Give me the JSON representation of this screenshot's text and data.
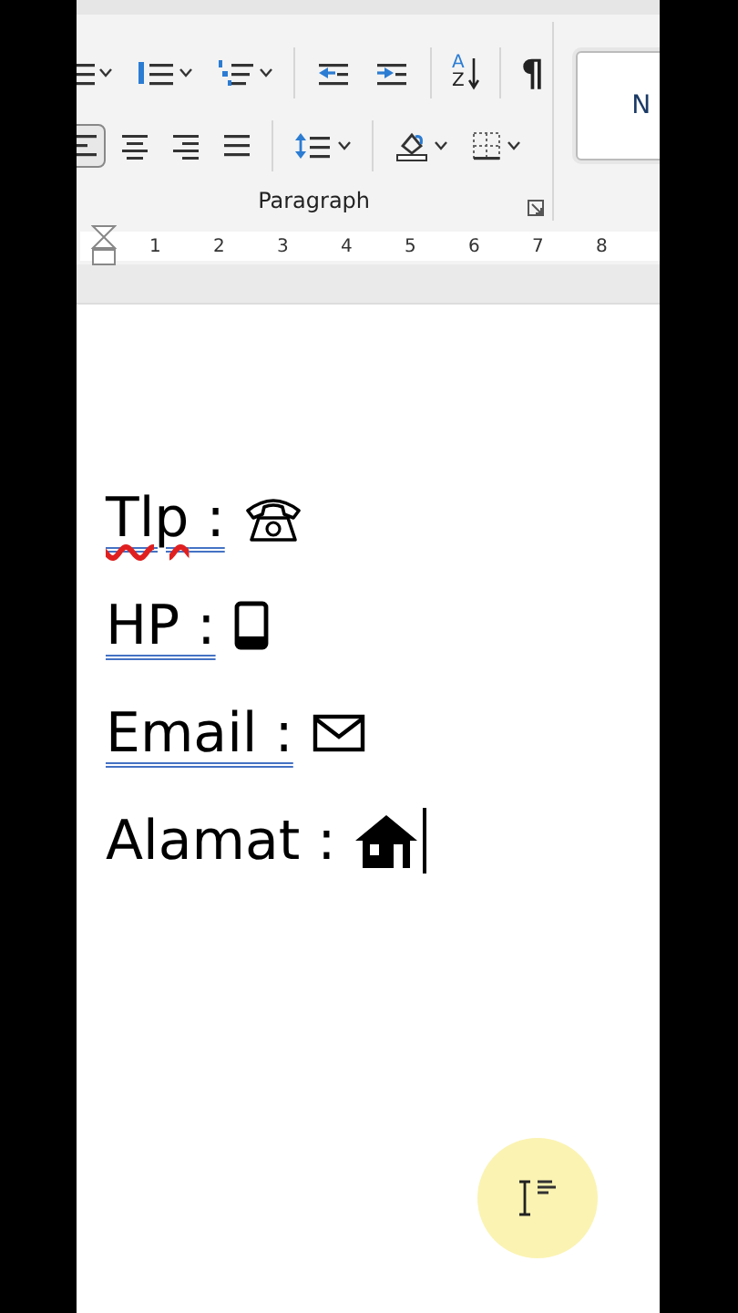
{
  "ribbon": {
    "row_1": [
      {
        "kind": "bullets",
        "dropdown": true,
        "selected": false
      },
      {
        "kind": "numbering",
        "dropdown": true,
        "selected": false
      },
      {
        "kind": "multilevel",
        "dropdown": true,
        "selected": false
      },
      {
        "kind": "outdent",
        "dropdown": false,
        "selected": false
      },
      {
        "kind": "indent",
        "dropdown": false,
        "selected": false
      },
      {
        "kind": "sort",
        "dropdown": false,
        "selected": false,
        "letters": [
          "A",
          "Z"
        ]
      },
      {
        "kind": "marks",
        "dropdown": false,
        "selected": false,
        "label": "¶"
      }
    ],
    "row_2": [
      {
        "kind": "left",
        "dropdown": false,
        "selected": true
      },
      {
        "kind": "center",
        "dropdown": false,
        "selected": false
      },
      {
        "kind": "right",
        "dropdown": false,
        "selected": false
      },
      {
        "kind": "justify",
        "dropdown": false,
        "selected": false
      },
      {
        "kind": "spacing",
        "dropdown": true,
        "selected": false
      },
      {
        "kind": "shading",
        "dropdown": true,
        "selected": false
      },
      {
        "kind": "borders",
        "dropdown": true,
        "selected": false
      }
    ],
    "group_label": "Paragraph",
    "style_preview": "N"
  },
  "ruler": {
    "numbers": [
      "1",
      "2",
      "3",
      "4",
      "5",
      "6",
      "7",
      "8"
    ]
  },
  "document": {
    "lines": [
      {
        "label": "Tlp :",
        "kind": "phone",
        "spelling_error": true,
        "grammar_underline": true,
        "caret": false
      },
      {
        "label": "HP :",
        "kind": "mobile",
        "spelling_error": false,
        "grammar_underline": true,
        "caret": false
      },
      {
        "label": "Email :",
        "kind": "mail",
        "spelling_error": false,
        "grammar_underline": true,
        "caret": false
      },
      {
        "label": "Alamat :",
        "kind": "home",
        "spelling_error": false,
        "grammar_underline": false,
        "caret": true
      }
    ]
  }
}
